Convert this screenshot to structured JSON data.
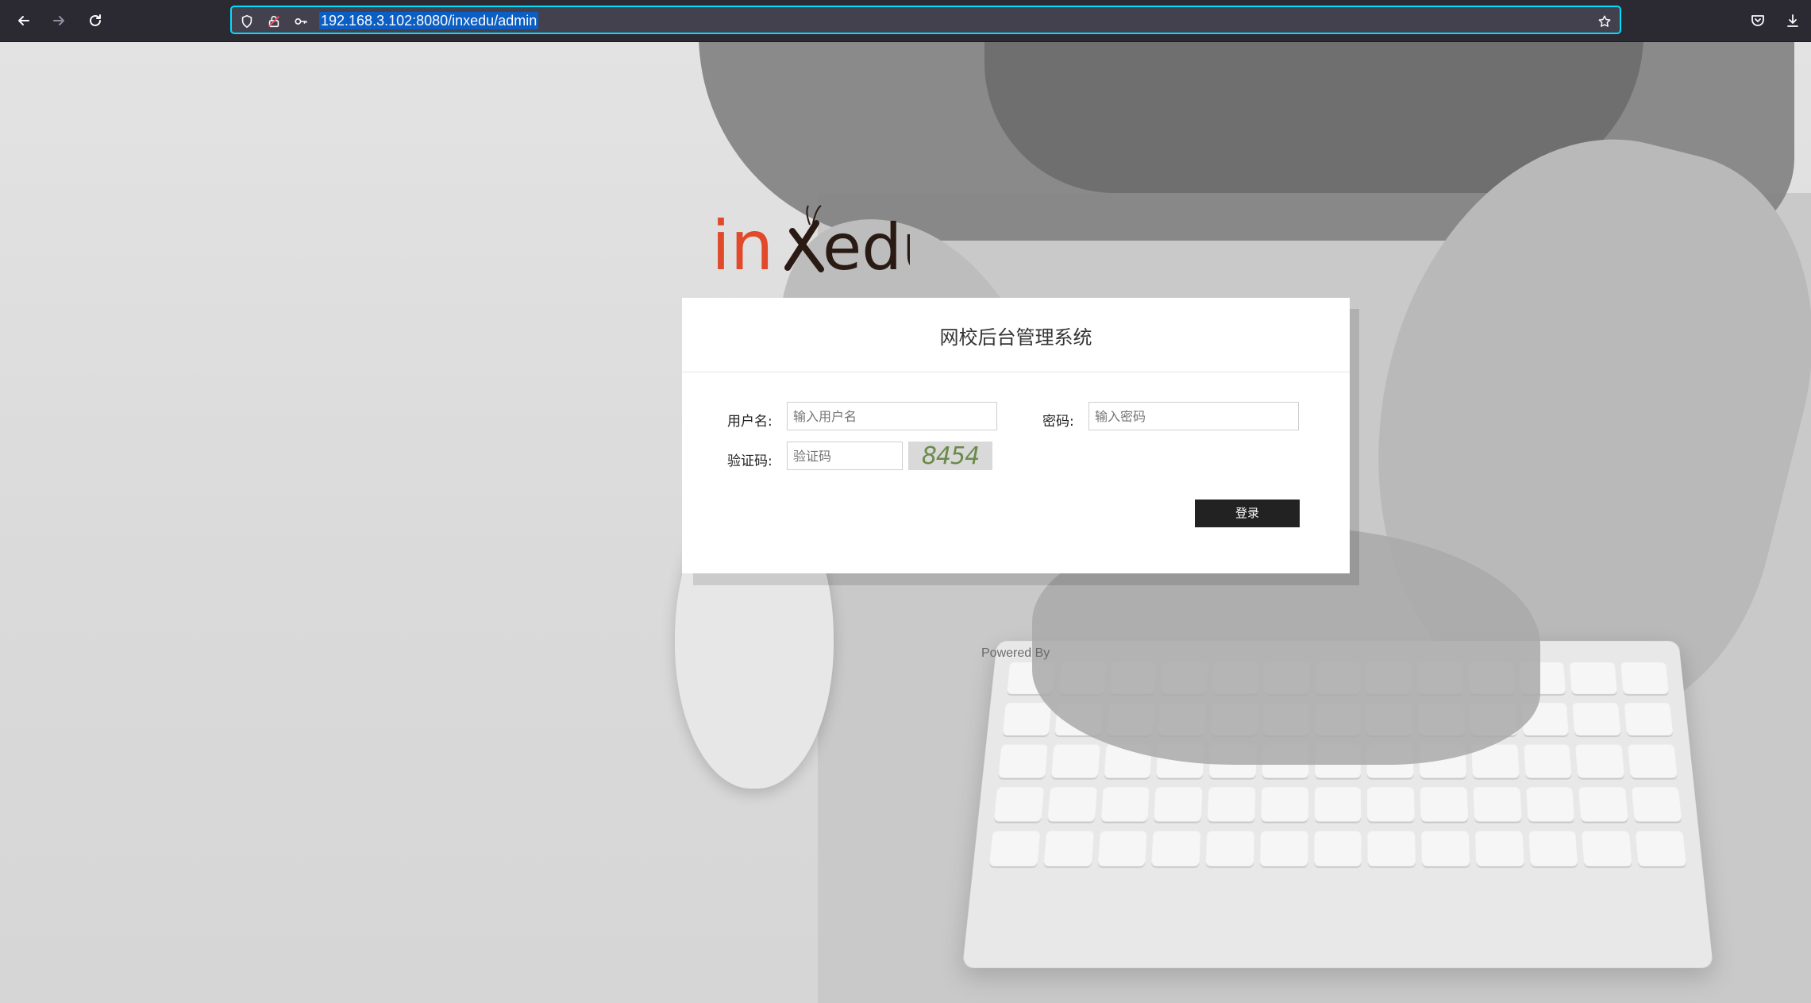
{
  "browser": {
    "url": "192.168.3.102:8080/inxedu/admin",
    "icons": [
      "back-arrow-icon",
      "forward-arrow-icon",
      "reload-icon",
      "shield-icon",
      "lock-slash-icon",
      "key-icon",
      "star-icon",
      "pocket-icon",
      "download-icon"
    ]
  },
  "logo": {
    "text": "inxedu"
  },
  "login": {
    "title": "网校后台管理系统",
    "username_label": "用户名:",
    "username_placeholder": "输入用户名",
    "password_label": "密码:",
    "password_placeholder": "输入密码",
    "captcha_label": "验证码:",
    "captcha_placeholder": "验证码",
    "captcha_code": "8454",
    "submit_label": "登录"
  },
  "footer": {
    "powered_by": "Powered By"
  },
  "colors": {
    "logo_orange": "#e0492a",
    "logo_dark": "#2a1a14",
    "button_bg": "#222222",
    "url_highlight": "#0b5ec3"
  }
}
